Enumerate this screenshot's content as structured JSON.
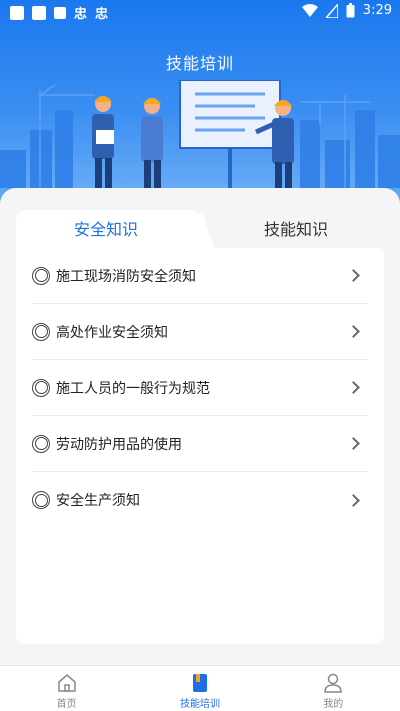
{
  "status_bar": {
    "time": "3:29",
    "glyphs": [
      "忠",
      "忠"
    ]
  },
  "header": {
    "title": "技能培训"
  },
  "tabs": [
    {
      "label": "安全知识",
      "active": true
    },
    {
      "label": "技能知识",
      "active": false
    }
  ],
  "list": {
    "items": [
      {
        "label": "施工现场消防安全须知"
      },
      {
        "label": "高处作业安全须知"
      },
      {
        "label": "施工人员的一般行为规范"
      },
      {
        "label": "劳动防护用品的使用"
      },
      {
        "label": "安全生产须知"
      }
    ]
  },
  "bottom_nav": {
    "items": [
      {
        "label": "首页",
        "icon": "home-icon",
        "active": false
      },
      {
        "label": "技能培训",
        "icon": "book-icon",
        "active": true
      },
      {
        "label": "我的",
        "icon": "user-icon",
        "active": false
      }
    ]
  },
  "colors": {
    "accent": "#1d6fe3",
    "hero": "#1a78ee",
    "background": "#f2f3f5"
  }
}
